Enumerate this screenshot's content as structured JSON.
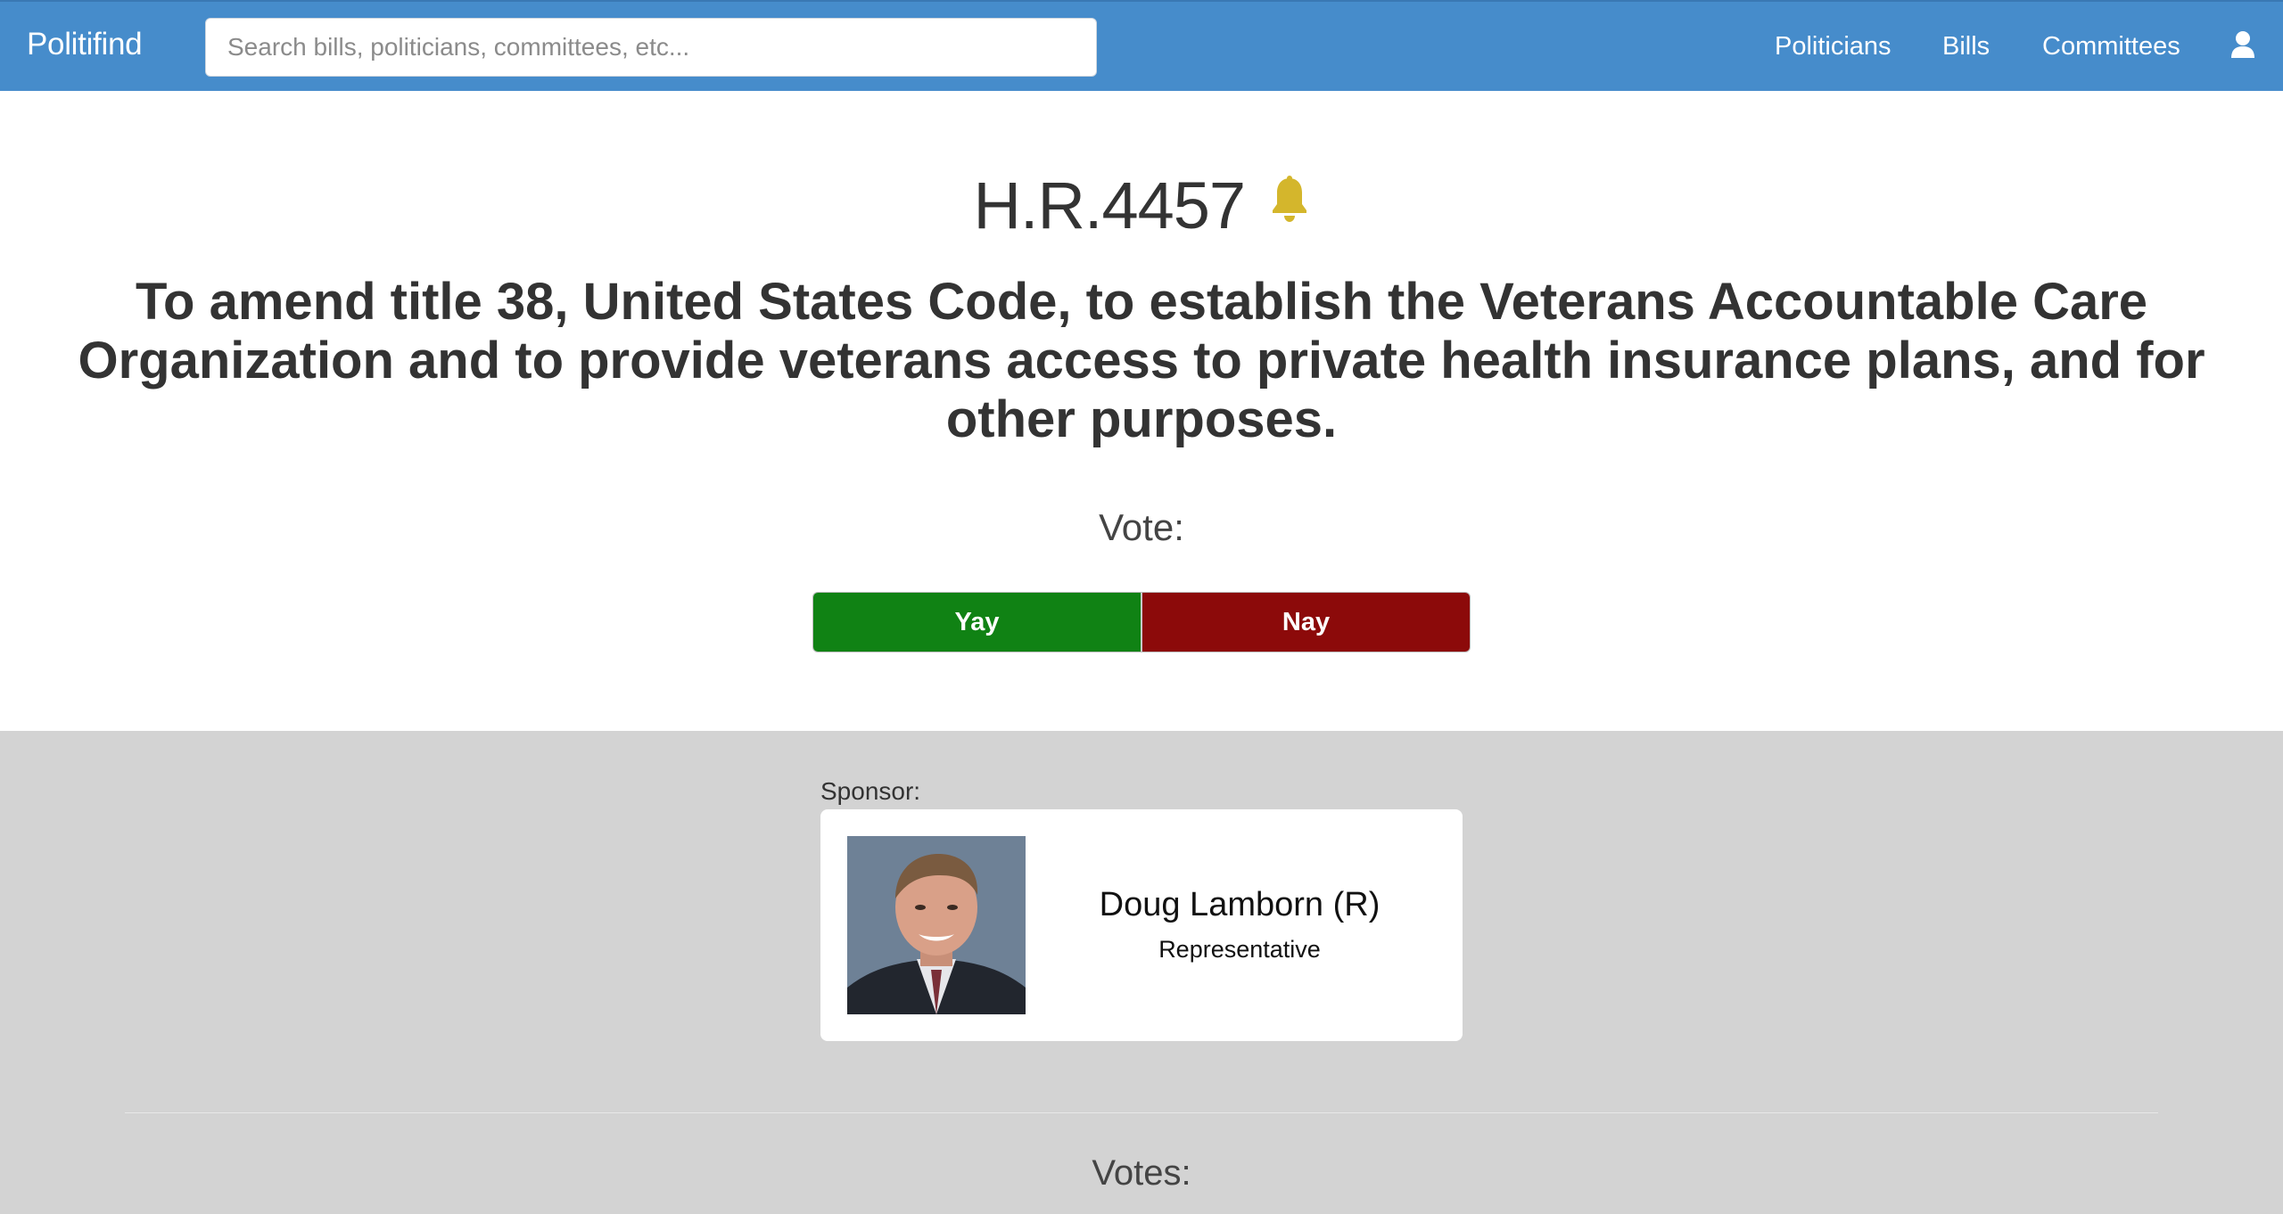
{
  "navbar": {
    "brand": "Politifind",
    "search_placeholder": "Search bills, politicians, committees, etc...",
    "links": [
      "Politicians",
      "Bills",
      "Committees"
    ],
    "user_icon": "user-icon",
    "background_color": "#468ccb"
  },
  "bill": {
    "number": "H.R.4457",
    "bell_icon": "bell-icon",
    "bell_color": "#d4b62c",
    "title": "To amend title 38, United States Code, to establish the Veterans Accountable Care Organization and to provide veterans access to private health insurance plans, and for other purposes."
  },
  "vote": {
    "label": "Vote:",
    "yay_label": "Yay",
    "nay_label": "Nay",
    "yay_color": "#108214",
    "nay_color": "#8c0a0a"
  },
  "sponsor": {
    "label": "Sponsor:",
    "name": "Doug Lamborn (R)",
    "role": "Representative"
  },
  "votes_section": {
    "label": "Votes:"
  }
}
